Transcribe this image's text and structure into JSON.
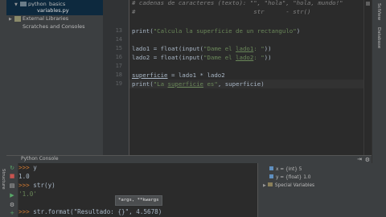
{
  "project_tree": [
    {
      "label": "python_basics",
      "indent": 1,
      "icon": "folder-icon",
      "selected": false
    },
    {
      "label": "variables.py",
      "indent": 2,
      "icon": "python-file-icon",
      "selected": true
    },
    {
      "label": "External Libraries",
      "indent": 0,
      "icon": "library-icon",
      "selected": false
    },
    {
      "label": "Scratches and Consoles",
      "indent": 0,
      "icon": "scratches-icon",
      "selected": false
    }
  ],
  "editor": {
    "line_numbers": [
      "",
      "",
      "13",
      "14",
      "15",
      "16",
      "17",
      "18",
      "19"
    ],
    "lines": [
      {
        "parts": [
          {
            "t": "# cadenas de caracteres (texto): \"\", \"hola\", \"hola, mundo!\"",
            "c": "cmt"
          }
        ]
      },
      {
        "parts": [
          {
            "t": "#                                 str      - str()",
            "c": "cmt"
          }
        ]
      },
      {
        "parts": []
      },
      {
        "parts": [
          {
            "t": "print(",
            "c": ""
          },
          {
            "t": "\"Calcula la superficie de un rectangulo\"",
            "c": "str"
          },
          {
            "t": ")",
            "c": ""
          }
        ]
      },
      {
        "parts": []
      },
      {
        "parts": [
          {
            "t": "lado1 = float(input(",
            "c": ""
          },
          {
            "t": "\"Dame el ",
            "c": "str"
          },
          {
            "t": "lado1",
            "c": "str-ul"
          },
          {
            "t": ": \"",
            "c": "str"
          },
          {
            "t": "))",
            "c": ""
          }
        ]
      },
      {
        "parts": [
          {
            "t": "lado2 = float(input(",
            "c": ""
          },
          {
            "t": "\"Dame el ",
            "c": "str"
          },
          {
            "t": "lado2",
            "c": "str-ul"
          },
          {
            "t": ": \"",
            "c": "str"
          },
          {
            "t": "))",
            "c": ""
          }
        ]
      },
      {
        "parts": []
      },
      {
        "parts": [
          {
            "t": "superficie",
            "c": "ul"
          },
          {
            "t": " = lado1 * lado2",
            "c": ""
          }
        ]
      },
      {
        "parts": [
          {
            "t": "print(",
            "c": ""
          },
          {
            "t": "\"La ",
            "c": "str"
          },
          {
            "t": "superficie",
            "c": "str-ul"
          },
          {
            "t": " es\"",
            "c": "str"
          },
          {
            "t": ", superficie)",
            "c": ""
          }
        ]
      }
    ],
    "gutter_rows": [
      "",
      "",
      "13",
      "14",
      "15",
      "16",
      "17",
      "18",
      "19"
    ]
  },
  "right_strip": {
    "labels": [
      "SciView",
      "Database"
    ]
  },
  "console": {
    "tab_label": "Python Console",
    "lines": [
      {
        "prompt": ">>> ",
        "text": "y",
        "kind": "input"
      },
      {
        "prompt": "",
        "text": "1.0",
        "kind": "out"
      },
      {
        "prompt": ">>> ",
        "text": "str(y)",
        "kind": "input"
      },
      {
        "prompt": "",
        "text": "'1.0'",
        "kind": "out-str"
      },
      {
        "prompt": "",
        "text": "",
        "kind": "out"
      },
      {
        "prompt": ">>> ",
        "text": "str.format(\"Resultado: {}\", 4.5678)",
        "kind": "input"
      }
    ],
    "tooltip": "*args, **kwargs"
  },
  "variables": [
    {
      "label": "x = {int} 5"
    },
    {
      "label": "y = {float} 1.0"
    },
    {
      "label": "Special Variables"
    }
  ],
  "colors": {
    "background": "#2b2b2b",
    "panel": "#3c3f41",
    "string": "#6a8759",
    "keyword": "#cc7832",
    "comment": "#808080"
  }
}
